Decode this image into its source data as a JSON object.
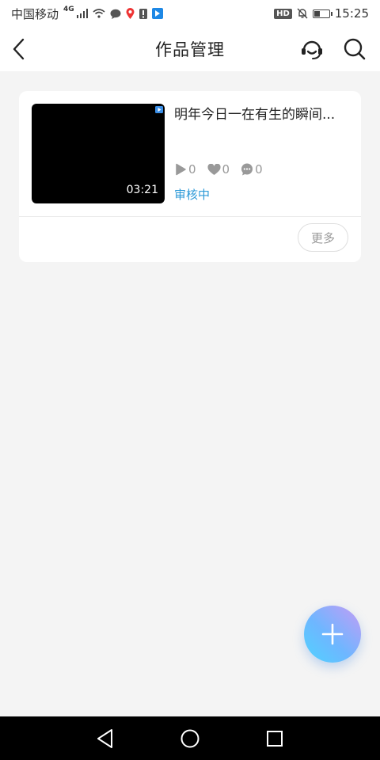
{
  "status_bar": {
    "carrier": "中国移动",
    "network": "4G",
    "hd_badge": "HD",
    "time": "15:25",
    "battery_level": 0.35
  },
  "header": {
    "title": "作品管理",
    "icons": [
      "back-icon",
      "headset-support-icon",
      "search-icon"
    ]
  },
  "works": [
    {
      "title": "明年今日一在有生的瞬间...",
      "duration": "03:21",
      "stats": {
        "plays": "0",
        "likes": "0",
        "comments": "0"
      },
      "status": "审核中",
      "more_label": "更多"
    }
  ],
  "fab": {
    "icon": "plus-icon"
  },
  "navbar": {
    "icons": [
      "back-triangle-icon",
      "home-circle-icon",
      "recents-square-icon"
    ]
  },
  "colors": {
    "accent_blue": "#2e9ad8",
    "background": "#f4f4f4",
    "card": "#ffffff"
  }
}
